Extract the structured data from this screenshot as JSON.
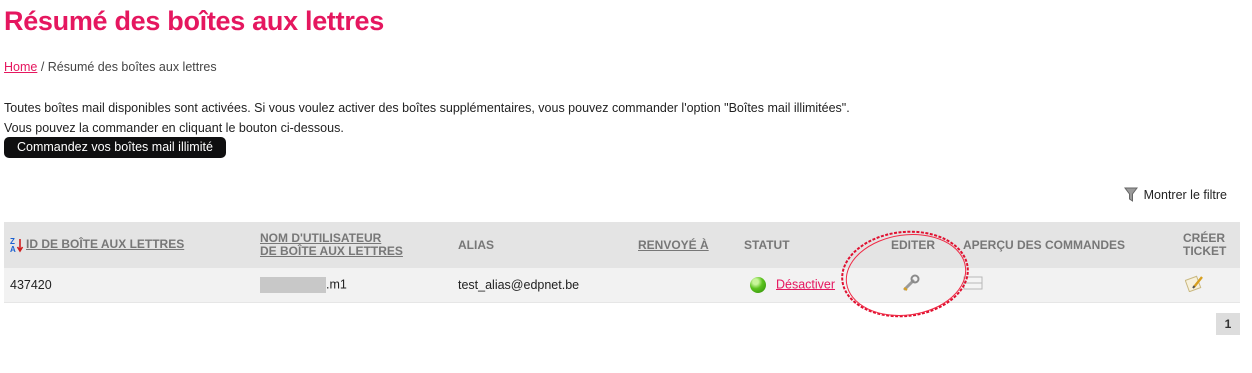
{
  "page": {
    "title": "Résumé des boîtes aux lettres",
    "breadcrumb": {
      "home": "Home",
      "separator": " / ",
      "current": "Résumé des boîtes aux lettres"
    },
    "info_line1": "Toutes boîtes mail disponibles sont activées. Si vous voulez activer des boîtes supplémentaires, vous pouvez commander l'option \"Boîtes mail illimitées\".",
    "info_line2": "Vous pouvez la commander en cliquant le bouton ci-dessous.",
    "order_button": "Commandez vos boîtes mail illimité",
    "filter_label": "Montrer le filtre"
  },
  "table": {
    "headers": {
      "id": "ID DE BOÎTE AUX LETTRES",
      "username_line1": "NOM D'UTILISATEUR",
      "username_line2": "DE BOÎTE AUX LETTRES",
      "alias": "ALIAS",
      "forwarded": "RENVOYÉ À",
      "status": "STATUT",
      "edit": "EDITER",
      "overview": "APERÇU DES COMMANDES",
      "ticket_line1": "CRÉER",
      "ticket_line2": "TICKET"
    },
    "rows": [
      {
        "id": "437420",
        "username_suffix": ".m1",
        "alias": "test_alias@edpnet.be",
        "status_action": "Désactiver"
      }
    ]
  },
  "pagination": {
    "current": "1"
  },
  "colors": {
    "accent": "#e5175f",
    "button_bg": "#0f0f10",
    "header_bg": "#e4e4e4",
    "row_bg": "#f2f2f2"
  },
  "icons": [
    "sort-az-icon",
    "filter-funnel-icon",
    "status-green-icon",
    "wrench-icon",
    "list-icon",
    "ticket-pencil-icon"
  ]
}
